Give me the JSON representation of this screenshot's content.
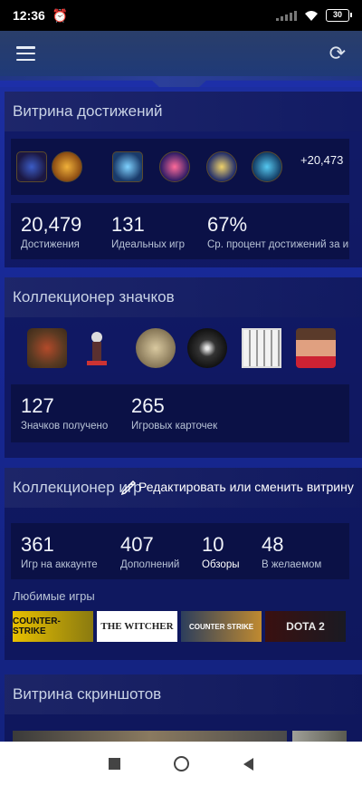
{
  "status": {
    "time": "12:36",
    "battery": "30"
  },
  "achievements": {
    "title": "Витрина достижений",
    "more": "+20,473",
    "stats": [
      {
        "value": "20,479",
        "label": "Достижения"
      },
      {
        "value": "131",
        "label": "Идеальных игр"
      },
      {
        "value": "67%",
        "label": "Ср. процент достижений за игру"
      }
    ]
  },
  "badges": {
    "title": "Коллекционер значков",
    "stats": [
      {
        "value": "127",
        "label": "Значков получено"
      },
      {
        "value": "265",
        "label": "Игровых карточек"
      }
    ]
  },
  "games": {
    "title": "Коллекционер игр",
    "tooltip": "Редактировать или сменить витрину",
    "stats": [
      {
        "value": "361",
        "label": "Игр на аккаунте"
      },
      {
        "value": "407",
        "label": "Дополнений"
      },
      {
        "value": "10",
        "label": "Обзоры"
      },
      {
        "value": "48",
        "label": "В желаемом"
      }
    ],
    "favorites_label": "Любимые игры",
    "favorites": [
      "COUNTER-STRIKE",
      "THE WITCHER",
      "COUNTER STRIKE",
      "DOTA 2"
    ]
  },
  "screenshots": {
    "title": "Витрина скриншотов"
  },
  "icons": {
    "menu": "hamburger-menu-icon",
    "refresh": "refresh-icon",
    "alarm": "alarm-clock-icon",
    "signal": "signal-icon",
    "wifi": "wifi-icon",
    "edit": "edit-pencil-icon"
  }
}
